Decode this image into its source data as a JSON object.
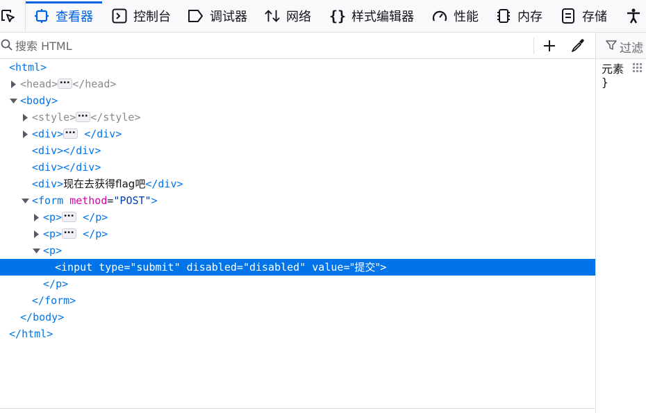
{
  "tabs": [
    {
      "label": "查看器",
      "icon": "inspector-icon",
      "active": true
    },
    {
      "label": "控制台",
      "icon": "console-icon"
    },
    {
      "label": "调试器",
      "icon": "debugger-icon"
    },
    {
      "label": "网络",
      "icon": "network-icon"
    },
    {
      "label": "样式编辑器",
      "icon": "style-editor-icon"
    },
    {
      "label": "性能",
      "icon": "performance-icon"
    },
    {
      "label": "内存",
      "icon": "memory-icon"
    },
    {
      "label": "存储",
      "icon": "storage-icon"
    }
  ],
  "search": {
    "placeholder": "搜索 HTML"
  },
  "rules_panel": {
    "filter_label": "过滤",
    "element_label": "元素",
    "brace": "}"
  },
  "markup": {
    "html_tag": "html",
    "head_tag": "head",
    "body_tag": "body",
    "style_tag": "style",
    "div_tag": "div",
    "div_text": "现在去获得flag吧",
    "form_tag": "form",
    "form_attr": "method",
    "form_attr_value": "\"POST\"",
    "p_tag": "p",
    "input_tag": "input",
    "input_attrs": [
      {
        "name": "type",
        "value": "\"submit\""
      },
      {
        "name": "disabled",
        "value": "\"disabled\""
      },
      {
        "name": "value",
        "value": "\"提交\""
      }
    ]
  },
  "colors": {
    "accent": "#0061e0",
    "selected_row": "#0074e8",
    "tag": "#0074e8",
    "attr_name": "#dd00a9",
    "attr_value": "#003eaa"
  }
}
